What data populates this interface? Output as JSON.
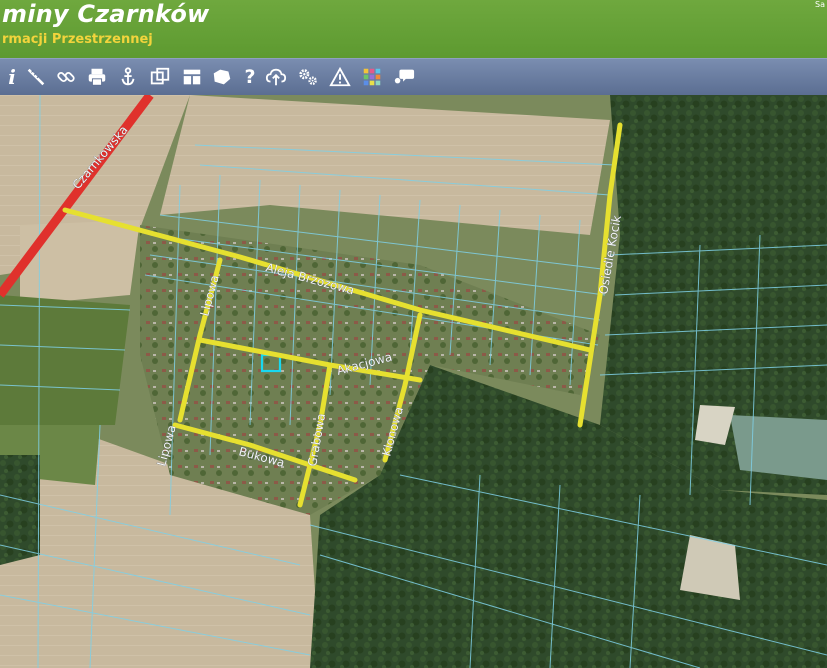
{
  "header": {
    "title": "miny Czarnków",
    "subtitle": "rmacji Przestrzennej",
    "corner": "Sa"
  },
  "toolbar": {
    "tools": [
      {
        "icon": "info-icon",
        "glyph": "i"
      },
      {
        "icon": "measure-ruler-icon"
      },
      {
        "icon": "link-icon"
      },
      {
        "icon": "print-icon"
      },
      {
        "icon": "anchor-icon"
      },
      {
        "icon": "copy-layers-icon"
      },
      {
        "icon": "layout-icon"
      },
      {
        "icon": "shape-icon"
      },
      {
        "icon": "help-icon",
        "glyph": "?"
      },
      {
        "icon": "cloud-upload-icon"
      },
      {
        "icon": "settings-gears-icon"
      },
      {
        "icon": "warning-icon"
      },
      {
        "icon": "color-grid-icon"
      },
      {
        "icon": "comment-icon"
      }
    ]
  },
  "map": {
    "streets": {
      "czarnkowska": "Czarnkowska",
      "aleja_brzozowa": "Aleja Brzozowa",
      "lipowa_north": "Lipowa",
      "lipowa_south": "Lipowa",
      "akacjowa": "Akacjowa",
      "klonowa": "Klonowa",
      "bukowa": "Bukowa",
      "grabowa": "Grabowa",
      "osiedle_kociki": "Osiedle Kocik"
    },
    "colors": {
      "road_main": "#e0312c",
      "road_local": "#e6e030",
      "parcel_lines": "#7fd0e6",
      "selected_parcel": "#18d8f0",
      "forest": "#2e4a2a",
      "field": "#c9bba2"
    }
  }
}
